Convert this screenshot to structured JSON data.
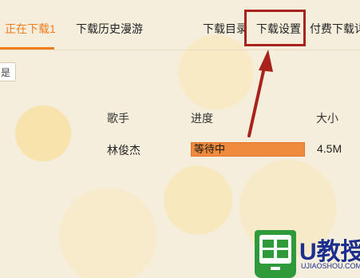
{
  "tabs": {
    "downloading": "正在下载1",
    "history": "下载历史漫游"
  },
  "toolbar": {
    "directory": "下载目录",
    "settings": "下载设置",
    "paid": "付费下载详"
  },
  "search": {
    "value": "是"
  },
  "table": {
    "headers": {
      "singer": "歌手",
      "progress": "进度",
      "size": "大小"
    },
    "rows": [
      {
        "singer": "林俊杰",
        "status": "等待中",
        "progress_percent": 100,
        "size": "4.5M"
      }
    ]
  },
  "watermark": {
    "brand": "U教授",
    "url": "UJIAOSHOU.COM"
  },
  "colors": {
    "accent": "#f07c1e",
    "progress": "#f08a3c",
    "highlight": "#a8231b",
    "watermark_green": "#2e9a3a",
    "watermark_blue": "#1d2f8c"
  }
}
